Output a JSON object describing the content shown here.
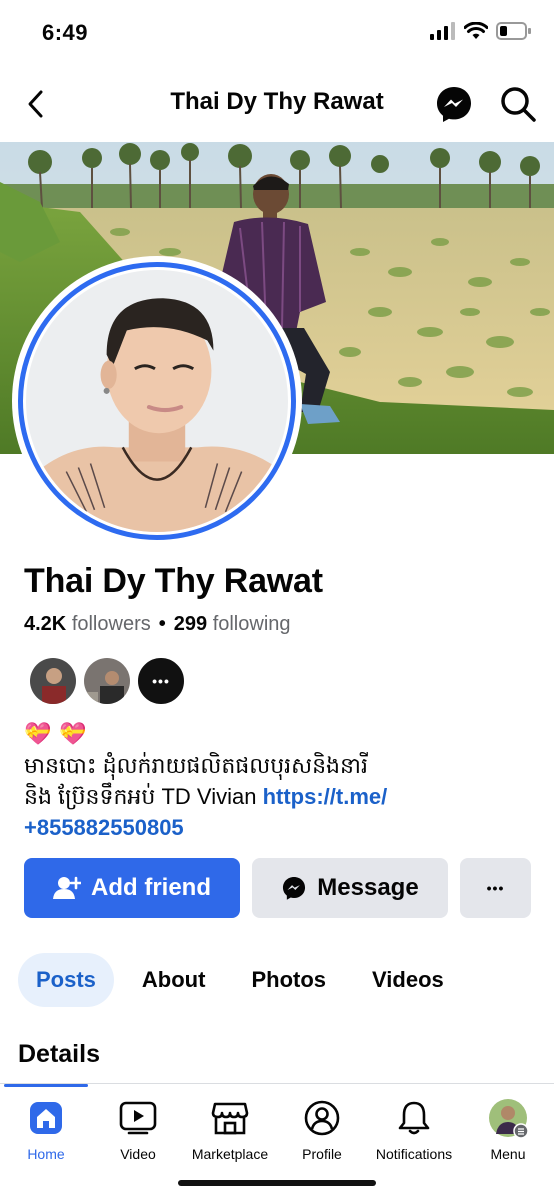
{
  "status": {
    "time": "6:49"
  },
  "header": {
    "title": "Thai Dy Thy Rawat"
  },
  "profile": {
    "name": "Thai Dy Thy Rawat",
    "followers_count": "4.2K",
    "followers_label": "followers",
    "separator": "•",
    "following_count": "299",
    "following_label": "following",
    "friends_more": "•••"
  },
  "bio": {
    "emoji": [
      "💝",
      "💝"
    ],
    "line1": "មានបោះ ដុំលក់រាយផលិតផលបុរសនិងនារី",
    "line2_text": "និង ប្រ៊ែនទឹកអប់ TD Vivian ",
    "link": "https://t.me/",
    "phone": "+855882550805"
  },
  "actions": {
    "add_friend": "Add friend",
    "message": "Message",
    "more": "•••"
  },
  "tabs": [
    {
      "label": "Posts",
      "active": true
    },
    {
      "label": "About"
    },
    {
      "label": "Photos"
    },
    {
      "label": "Videos"
    }
  ],
  "section": {
    "details": "Details"
  },
  "bottom_nav": [
    {
      "label": "Home",
      "icon": "home-icon",
      "active": true
    },
    {
      "label": "Video",
      "icon": "video-icon"
    },
    {
      "label": "Marketplace",
      "icon": "marketplace-icon"
    },
    {
      "label": "Profile",
      "icon": "profile-icon"
    },
    {
      "label": "Notifications",
      "icon": "bell-icon"
    },
    {
      "label": "Menu",
      "icon": "menu-avatar-icon"
    }
  ],
  "colors": {
    "accent": "#2f69e9",
    "link": "#1b61c9",
    "tab_active_bg": "#e7f0fc",
    "button_gray": "#e4e6eb"
  }
}
